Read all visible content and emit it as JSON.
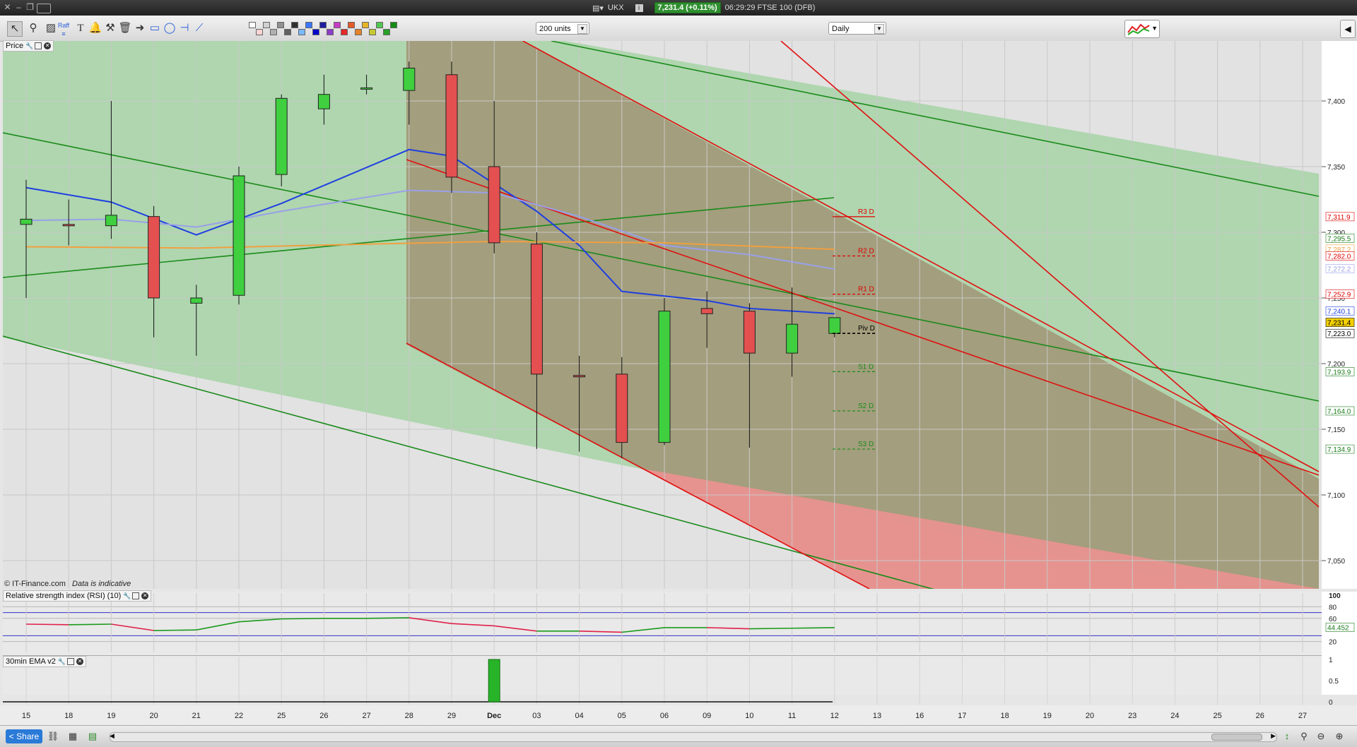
{
  "window": {
    "instrument": "UKX",
    "price_badge": "7,231.4 (+0.11%)",
    "time_name": "06:29:29 FTSE 100 (DFB)"
  },
  "toolbar": {
    "units_value": "200 units",
    "interval_value": "Daily",
    "tools": [
      "pointer-tool",
      "zoom-tool",
      "fibonacci-tool",
      "text-tool",
      "alert-tool",
      "pitchfork-tool",
      "delete-tool",
      "arrow-tool",
      "rectangle-tool",
      "ellipse-tool",
      "horizontal-line-tool",
      "trend-line-tool"
    ],
    "palette": [
      "#ffffff",
      "#ffd4d4",
      "#d0d0d0",
      "#b0b0b0",
      "#909090",
      "#606060",
      "#303030",
      "#7ab8ff",
      "#3c78ff",
      "#0000c8",
      "#1e1ea0",
      "#8c3cc8",
      "#c83cc8",
      "#e62828",
      "#e65a28",
      "#e68228",
      "#e6b428",
      "#c8c832",
      "#50c850",
      "#28a028",
      "#148c14"
    ]
  },
  "panels": {
    "price_label": "Price",
    "rsi_label": "Relative strength index (RSI) (10)",
    "ema_label": "30min EMA v2",
    "watermark": "© IT-Finance.com",
    "watermark_note": "Data is indicative"
  },
  "bottom": {
    "share_label": "Share"
  },
  "chart_data": {
    "type": "candlestick",
    "x_labels": [
      "15",
      "18",
      "19",
      "20",
      "21",
      "22",
      "25",
      "26",
      "27",
      "28",
      "29",
      "Dec",
      "03",
      "04",
      "05",
      "06",
      "09",
      "10",
      "11",
      "12",
      "13",
      "16",
      "17",
      "18",
      "19",
      "20",
      "23",
      "24",
      "25",
      "26",
      "27"
    ],
    "candles": [
      {
        "i": 0,
        "open": 7306,
        "high": 7340,
        "low": 7250,
        "close": 7310
      },
      {
        "i": 1,
        "open": 7306,
        "high": 7325,
        "low": 7290,
        "close": 7305
      },
      {
        "i": 2,
        "open": 7305,
        "high": 7400,
        "low": 7295,
        "close": 7313
      },
      {
        "i": 3,
        "open": 7312,
        "high": 7320,
        "low": 7220,
        "close": 7250
      },
      {
        "i": 4,
        "open": 7246,
        "high": 7260,
        "low": 7206,
        "close": 7250
      },
      {
        "i": 5,
        "open": 7252,
        "high": 7350,
        "low": 7245,
        "close": 7343
      },
      {
        "i": 6,
        "open": 7344,
        "high": 7405,
        "low": 7335,
        "close": 7402
      },
      {
        "i": 7,
        "open": 7394,
        "high": 7420,
        "low": 7382,
        "close": 7405
      },
      {
        "i": 8,
        "open": 7410,
        "high": 7420,
        "low": 7405,
        "close": 7410
      },
      {
        "i": 9,
        "open": 7408,
        "high": 7430,
        "low": 7382,
        "close": 7425
      },
      {
        "i": 10,
        "open": 7420,
        "high": 7430,
        "low": 7330,
        "close": 7342
      },
      {
        "i": 11,
        "open": 7350,
        "high": 7400,
        "low": 7284,
        "close": 7292
      },
      {
        "i": 12,
        "open": 7291,
        "high": 7300,
        "low": 7135,
        "close": 7192
      },
      {
        "i": 13,
        "open": 7191,
        "high": 7206,
        "low": 7133,
        "close": 7190
      },
      {
        "i": 14,
        "open": 7192,
        "high": 7205,
        "low": 7128,
        "close": 7140
      },
      {
        "i": 15,
        "open": 7140,
        "high": 7250,
        "low": 7138,
        "close": 7240
      },
      {
        "i": 16,
        "open": 7242,
        "high": 7255,
        "low": 7212,
        "close": 7238
      },
      {
        "i": 17,
        "open": 7240,
        "high": 7246,
        "low": 7136,
        "close": 7208
      },
      {
        "i": 18,
        "open": 7208,
        "high": 7258,
        "low": 7190,
        "close": 7230
      },
      {
        "i": 19,
        "open": 7223,
        "high": 7235,
        "low": 7220,
        "close": 7235
      }
    ],
    "moving_averages": [
      {
        "name": "ma-blue",
        "color": "#1f3fe0",
        "points": [
          [
            0,
            7334
          ],
          [
            2,
            7323
          ],
          [
            4,
            7298
          ],
          [
            6,
            7322
          ],
          [
            9,
            7363
          ],
          [
            10,
            7358
          ],
          [
            12,
            7316
          ],
          [
            13,
            7290
          ],
          [
            14,
            7255
          ],
          [
            16,
            7248
          ],
          [
            17,
            7242
          ],
          [
            19,
            7238
          ]
        ]
      },
      {
        "name": "ma-lavender",
        "color": "#9aa0e8",
        "points": [
          [
            0,
            7309
          ],
          [
            2,
            7310
          ],
          [
            4,
            7304
          ],
          [
            6,
            7316
          ],
          [
            9,
            7332
          ],
          [
            11,
            7330
          ],
          [
            13,
            7312
          ],
          [
            15,
            7290
          ],
          [
            17,
            7283
          ],
          [
            19,
            7272
          ]
        ]
      },
      {
        "name": "ma-orange",
        "color": "#f0a040",
        "points": [
          [
            0,
            7289
          ],
          [
            4,
            7288
          ],
          [
            8,
            7291
          ],
          [
            11,
            7293
          ],
          [
            15,
            7292
          ],
          [
            19,
            7287
          ]
        ]
      }
    ],
    "pivot_levels": [
      {
        "label": "R3 D",
        "value": 7311.9,
        "color": "#e00000"
      },
      {
        "label": "R2 D",
        "value": 7282.0,
        "color": "#e00000"
      },
      {
        "label": "R1 D",
        "value": 7252.9,
        "color": "#e00000"
      },
      {
        "label": "Piv D",
        "value": 7223.0,
        "color": "#000000"
      },
      {
        "label": "S1 D",
        "value": 7193.9,
        "color": "#1a8a1a"
      },
      {
        "label": "S2 D",
        "value": 7164.0,
        "color": "#1a8a1a"
      },
      {
        "label": "S3 D",
        "value": 7134.9,
        "color": "#1a8a1a"
      }
    ],
    "price_ticks": [
      "7,400",
      "7,350",
      "7,300",
      "7,250",
      "7,200",
      "7,150",
      "7,100",
      "7,050"
    ],
    "right_tags": [
      {
        "text": "7,311.9",
        "color": "#e00000",
        "bg": "#ffffff",
        "value": 7311.9
      },
      {
        "text": "7,295.5",
        "color": "#1a7a1a",
        "bg": "#ffffff",
        "value": 7295.5
      },
      {
        "text": "7,287.2",
        "color": "#f0a040",
        "bg": "#ffffff",
        "value": 7287.2
      },
      {
        "text": "7,282.0",
        "color": "#e00000",
        "bg": "#ffffff",
        "value": 7282.0
      },
      {
        "text": "7,272.2",
        "color": "#9aa0e8",
        "bg": "#ffffff",
        "value": 7272.2
      },
      {
        "text": "7,252.9",
        "color": "#e00000",
        "bg": "#ffffff",
        "value": 7252.9
      },
      {
        "text": "7,240.1",
        "color": "#1f3fe0",
        "bg": "#ffffff",
        "value": 7240.1
      },
      {
        "text": "7,231.4",
        "color": "#000000",
        "bg": "#f5d000",
        "value": 7231.4
      },
      {
        "text": "7,223.0",
        "color": "#000000",
        "bg": "#ffffff",
        "value": 7223.0
      },
      {
        "text": "7,193.9",
        "color": "#1a7a1a",
        "bg": "#ffffff",
        "value": 7193.9
      },
      {
        "text": "7,164.0",
        "color": "#1a7a1a",
        "bg": "#ffffff",
        "value": 7164.0
      },
      {
        "text": "7,134.9",
        "color": "#1a7a1a",
        "bg": "#ffffff",
        "value": 7134.9
      }
    ],
    "rsi": {
      "levels": [
        "100",
        "80",
        "60",
        "44.452",
        "20"
      ],
      "current": 44.452,
      "points": [
        [
          0,
          50
        ],
        [
          1,
          49
        ],
        [
          2,
          50
        ],
        [
          3,
          39
        ],
        [
          4,
          40
        ],
        [
          5,
          54
        ],
        [
          6,
          59
        ],
        [
          7,
          60
        ],
        [
          8,
          60
        ],
        [
          9,
          61
        ],
        [
          10,
          51
        ],
        [
          11,
          47
        ],
        [
          12,
          38
        ],
        [
          13,
          38
        ],
        [
          14,
          36
        ],
        [
          15,
          44
        ],
        [
          16,
          44
        ],
        [
          17,
          42
        ],
        [
          18,
          43
        ],
        [
          19,
          44
        ]
      ]
    },
    "ema": {
      "ticks": [
        "1",
        "0.5",
        "0"
      ],
      "bar_index": 11,
      "bar_value": 1
    }
  }
}
